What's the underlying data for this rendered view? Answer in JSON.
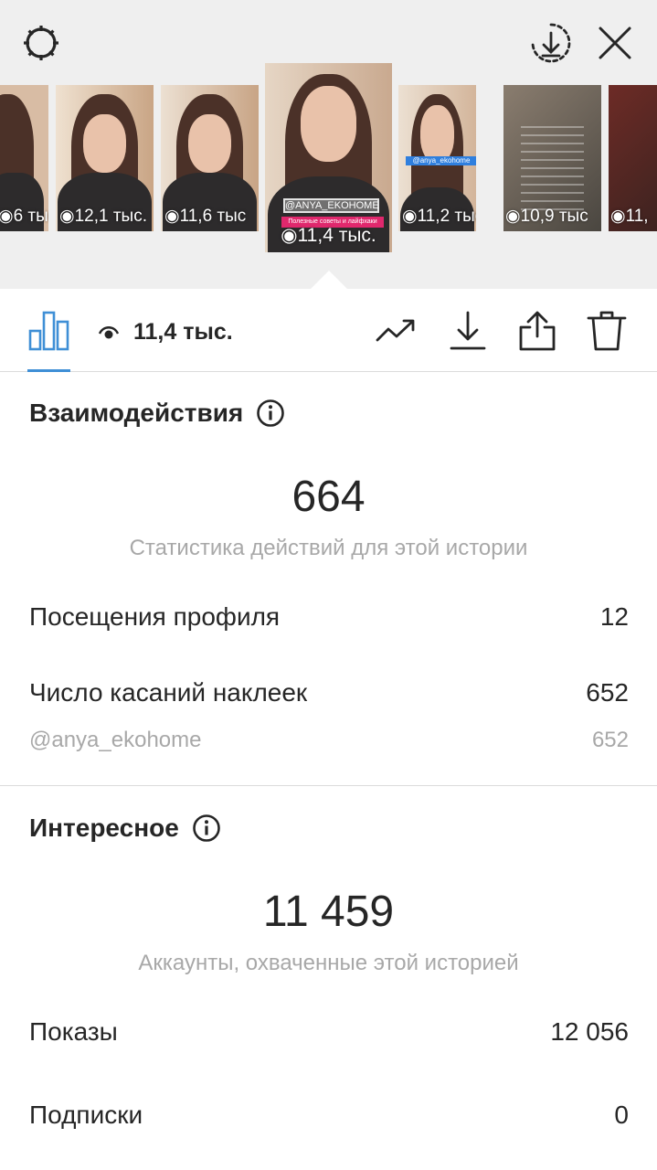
{
  "header": {
    "settings_icon": "gear-icon",
    "save_icon": "download-circle-icon",
    "close_icon": "close-icon"
  },
  "stories": [
    {
      "views": "6 тыс",
      "kind": "person"
    },
    {
      "views": "12,1 тыс.",
      "kind": "person"
    },
    {
      "views": "11,6 тыс",
      "kind": "person"
    },
    {
      "views": "11,4 тыс.",
      "kind": "person",
      "selected": true,
      "sticker": "@ANYA_EKOHOME",
      "banner": "Полезные советы и лайфхаки"
    },
    {
      "views": "11,2 тыс",
      "kind": "person",
      "sticker": "@anya_ekohome"
    },
    {
      "views": "10,9 тыс",
      "kind": "menu"
    },
    {
      "views": "11,",
      "kind": "dark"
    }
  ],
  "toolbar": {
    "insights_icon": "bar-chart-icon",
    "views_label": "11,4 тыс.",
    "promote_icon": "trending-up-icon",
    "download_icon": "download-icon",
    "share_icon": "share-icon",
    "delete_icon": "trash-icon",
    "active_color": "#3f8fd6"
  },
  "interactions": {
    "title": "Взаимодействия",
    "total": "664",
    "caption": "Статистика действий для этой истории",
    "rows": [
      {
        "label": "Посещения профиля",
        "value": "12"
      },
      {
        "label": "Число касаний наклеек",
        "value": "652"
      },
      {
        "label": "@anya_ekohome",
        "value": "652"
      }
    ]
  },
  "discovery": {
    "title": "Интересное",
    "total": "11 459",
    "caption": "Аккаунты, охваченные этой историей",
    "rows": [
      {
        "label": "Показы",
        "value": "12 056"
      },
      {
        "label": "Подписки",
        "value": "0"
      }
    ]
  }
}
